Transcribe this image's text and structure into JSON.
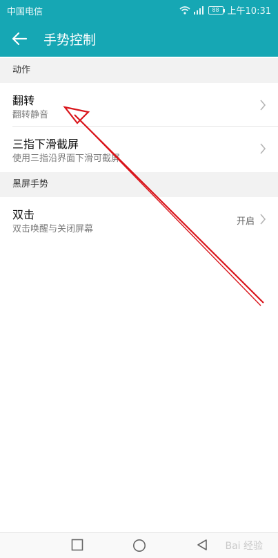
{
  "status_bar": {
    "carrier": "中国电信",
    "battery": "88",
    "time": "上午10:31",
    "icons": [
      "wifi-icon",
      "signal-icon"
    ]
  },
  "app_bar": {
    "back_icon": "arrow-left-icon",
    "title": "手势控制"
  },
  "sections": [
    {
      "header": "动作",
      "items": [
        {
          "title": "翻转",
          "subtitle": "翻转静音"
        },
        {
          "title": "三指下滑截屏",
          "subtitle": "使用三指沿界面下滑可截屏"
        }
      ]
    },
    {
      "header": "黑屏手势",
      "items": [
        {
          "title": "双击",
          "subtitle": "双击唤醒与关闭屏幕",
          "value": "开启"
        }
      ]
    }
  ],
  "nav_bar": {
    "buttons": [
      "recent-apps-icon",
      "home-icon",
      "back-triangle-icon"
    ],
    "watermark": "Bai 经验"
  },
  "colors": {
    "accent": "#16a7b4",
    "annotation_arrow": "#d9151b"
  }
}
